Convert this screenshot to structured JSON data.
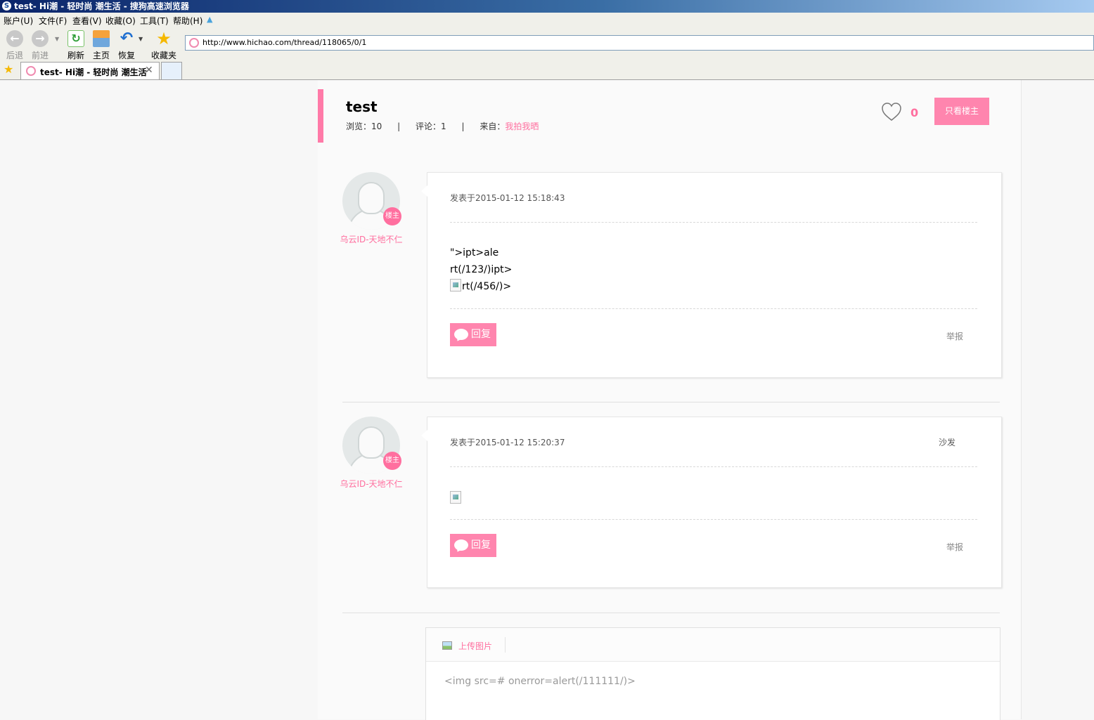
{
  "window": {
    "title": "test- Hi潮 - 轻时尚 潮生活 - 搜狗高速浏览器"
  },
  "menu": {
    "items": [
      "账户(U)",
      "文件(F)",
      "查看(V)",
      "收藏(O)",
      "工具(T)",
      "帮助(H)"
    ]
  },
  "toolbar": {
    "back": "后退",
    "forward": "前进",
    "refresh": "刷新",
    "home": "主页",
    "restore": "恢复",
    "favorites": "收藏夹",
    "address": "http://www.hichao.com/thread/118065/0/1"
  },
  "tab": {
    "title": "test- Hi潮 - 轻时尚 潮生活"
  },
  "thread": {
    "title": "test",
    "views_label": "浏览：10",
    "comments_label": "评论：1",
    "source_prefix": "来自：",
    "source": "我拍我晒",
    "likes": "0",
    "only_owner_button": "只看楼主",
    "separator": "|"
  },
  "posts": [
    {
      "user": "乌云ID-天地不仁",
      "badge": "楼主",
      "time": "发表于2015-01-12 15:18:43",
      "lines": [
        "\">ipt>ale",
        "rt(/123/)ipt>",
        "rt(/456/)>"
      ],
      "reply": "回复",
      "report": "举报"
    },
    {
      "user": "乌云ID-天地不仁",
      "badge": "楼主",
      "time": "发表于2015-01-12 15:20:37",
      "floor": "沙发",
      "reply": "回复",
      "report": "举报"
    }
  ],
  "editor": {
    "upload_label": "上传图片",
    "text": "<img src=# onerror=alert(/111111/)>"
  },
  "colors": {
    "accent": "#ff85ae",
    "accent_text": "#ff6f9f"
  }
}
